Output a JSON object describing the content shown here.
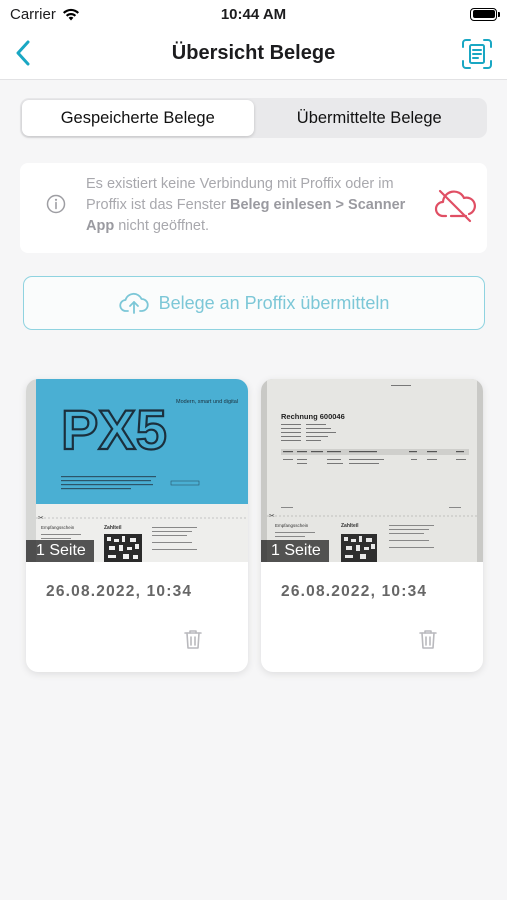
{
  "status": {
    "carrier": "Carrier",
    "time": "10:44 AM"
  },
  "nav": {
    "title": "Übersicht Belege",
    "back_icon": "chevron-left-icon",
    "action_icon": "document-scan-icon",
    "accent_color": "#19a7c3"
  },
  "tabs": [
    {
      "label": "Gespeicherte Belege",
      "selected": true
    },
    {
      "label": "Übermittelte Belege",
      "selected": false
    }
  ],
  "info": {
    "text_1": "Es existiert keine Verbindung mit Proffix oder im Proffix ist das Fenster ",
    "text_bold": "Beleg einlesen > Scanner App",
    "text_2": " nicht geöffnet.",
    "status_icon": "cloud-off-icon",
    "status_color": "#e04f64"
  },
  "upload": {
    "label": "Belege an Proffix übermitteln",
    "icon": "cloud-upload-icon"
  },
  "receipts": [
    {
      "pages": "1 Seite",
      "date": "26.08.2022, 10:34",
      "thumb_heading": "PX5",
      "thumb_tagline": "Modern, smart und digital",
      "thumb_slip_title": "Zahlteil",
      "thumb_slip_label": "Empfangsschein"
    },
    {
      "pages": "1 Seite",
      "date": "26.08.2022, 10:34",
      "thumb_heading": "Rechnung 600046",
      "thumb_slip_title": "Zahlteil",
      "thumb_slip_label": "Empfangsschein"
    }
  ]
}
